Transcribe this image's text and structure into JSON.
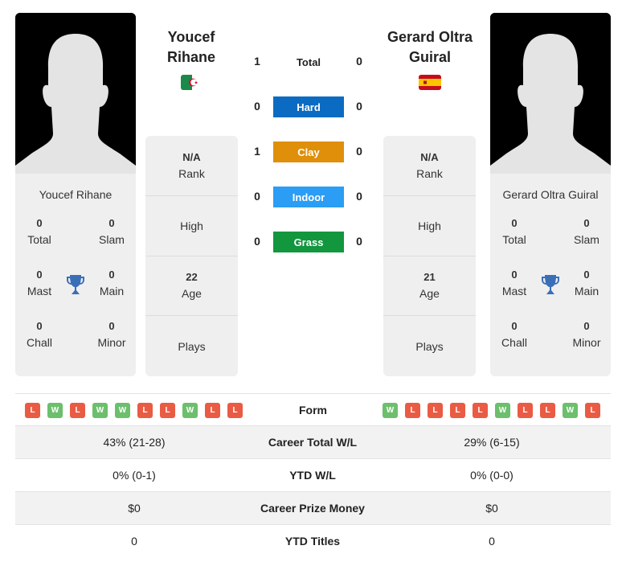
{
  "player1": {
    "name": "Youcef Rihane",
    "name_line1": "Youcef",
    "name_line2": "Rihane",
    "flag": "algeria-flag",
    "titles": {
      "total": {
        "value": "0",
        "label": "Total"
      },
      "slam": {
        "value": "0",
        "label": "Slam"
      },
      "mast": {
        "value": "0",
        "label": "Mast"
      },
      "main": {
        "value": "0",
        "label": "Main"
      },
      "chall": {
        "value": "0",
        "label": "Chall"
      },
      "minor": {
        "value": "0",
        "label": "Minor"
      }
    },
    "info": {
      "rank_value": "N/A",
      "rank_label": "Rank",
      "high_label": "High",
      "age_value": "22",
      "age_label": "Age",
      "plays_label": "Plays"
    },
    "form": [
      "L",
      "W",
      "L",
      "W",
      "W",
      "L",
      "L",
      "W",
      "L",
      "L"
    ]
  },
  "player2": {
    "name": "Gerard Oltra Guiral",
    "name_line1": "Gerard Oltra",
    "name_line2": "Guiral",
    "flag": "spain-flag",
    "titles": {
      "total": {
        "value": "0",
        "label": "Total"
      },
      "slam": {
        "value": "0",
        "label": "Slam"
      },
      "mast": {
        "value": "0",
        "label": "Mast"
      },
      "main": {
        "value": "0",
        "label": "Main"
      },
      "chall": {
        "value": "0",
        "label": "Chall"
      },
      "minor": {
        "value": "0",
        "label": "Minor"
      }
    },
    "info": {
      "rank_value": "N/A",
      "rank_label": "Rank",
      "high_label": "High",
      "age_value": "21",
      "age_label": "Age",
      "plays_label": "Plays"
    },
    "form": [
      "W",
      "L",
      "L",
      "L",
      "L",
      "W",
      "L",
      "L",
      "W",
      "L"
    ]
  },
  "h2h": [
    {
      "label": "Total",
      "p1": "1",
      "p2": "0",
      "color": ""
    },
    {
      "label": "Hard",
      "p1": "0",
      "p2": "0",
      "color": "#0b6bc2"
    },
    {
      "label": "Clay",
      "p1": "1",
      "p2": "0",
      "color": "#df8f0a"
    },
    {
      "label": "Indoor",
      "p1": "0",
      "p2": "0",
      "color": "#2b9df4"
    },
    {
      "label": "Grass",
      "p1": "0",
      "p2": "0",
      "color": "#12963e"
    }
  ],
  "form_label": "Form",
  "stats": [
    {
      "label": "Career Total W/L",
      "p1": "43% (21-28)",
      "p2": "29% (6-15)"
    },
    {
      "label": "YTD W/L",
      "p1": "0% (0-1)",
      "p2": "0% (0-0)"
    },
    {
      "label": "Career Prize Money",
      "p1": "$0",
      "p2": "$0"
    },
    {
      "label": "YTD Titles",
      "p1": "0",
      "p2": "0"
    }
  ],
  "colors": {
    "win": "#6cbf6c",
    "loss": "#ea5b44",
    "trophy": "#3a6fb8"
  }
}
